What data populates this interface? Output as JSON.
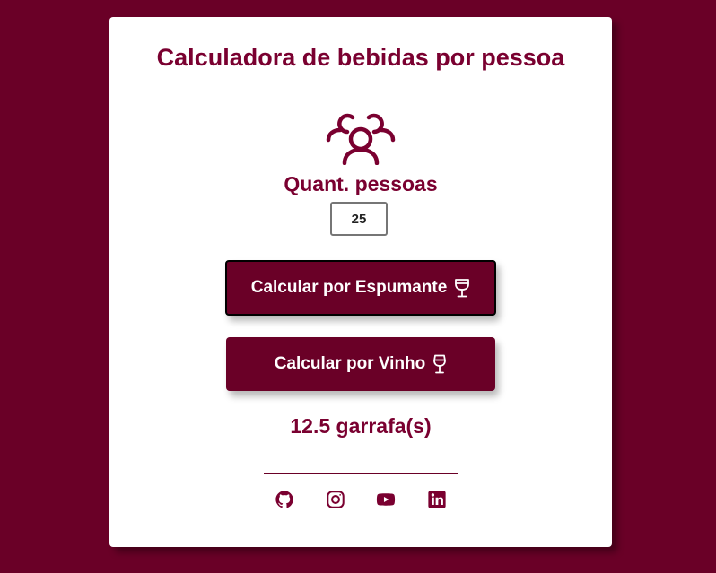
{
  "page": {
    "title": "Calculadora de bebidas por pessoa"
  },
  "form": {
    "quantity_label": "Quant. pessoas",
    "quantity_value": "25",
    "quantity_icon": "users-icon"
  },
  "buttons": {
    "espumante_label": "Calcular por Espumante",
    "espumante_icon": "champagne-glass-icon",
    "vinho_label": "Calcular por Vinho",
    "vinho_icon": "wine-glass-icon"
  },
  "result": {
    "text": "12.5 garrafa(s)"
  },
  "footer": {
    "social": [
      {
        "name": "github",
        "icon": "github-icon"
      },
      {
        "name": "instagram",
        "icon": "instagram-icon"
      },
      {
        "name": "youtube",
        "icon": "youtube-icon"
      },
      {
        "name": "linkedin",
        "icon": "linkedin-icon"
      }
    ]
  },
  "colors": {
    "background": "#6a0027",
    "accent": "#7a0030",
    "card": "#ffffff",
    "button_text": "#ffffff"
  }
}
